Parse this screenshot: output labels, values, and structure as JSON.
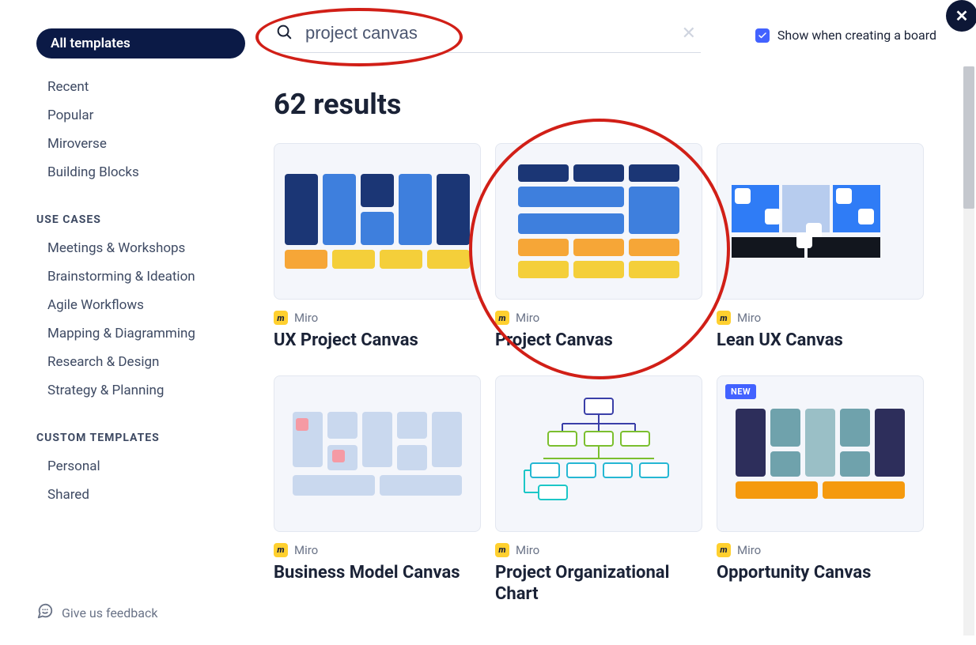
{
  "sidebar": {
    "primary_label": "All templates",
    "items": [
      "Recent",
      "Popular",
      "Miroverse",
      "Building Blocks"
    ],
    "use_cases_title": "USE CASES",
    "use_cases": [
      "Meetings & Workshops",
      "Brainstorming & Ideation",
      "Agile Workflows",
      "Mapping & Diagramming",
      "Research & Design",
      "Strategy & Planning"
    ],
    "custom_title": "CUSTOM TEMPLATES",
    "custom": [
      "Personal",
      "Shared"
    ],
    "feedback_label": "Give us feedback"
  },
  "search": {
    "value": "project canvas",
    "show_when_label": "Show when creating a board"
  },
  "results": {
    "heading": "62 results"
  },
  "cards": [
    {
      "author": "Miro",
      "title": "UX Project Canvas"
    },
    {
      "author": "Miro",
      "title": "Project Canvas"
    },
    {
      "author": "Miro",
      "title": "Lean UX Canvas"
    },
    {
      "author": "Miro",
      "title": "Business Model Canvas"
    },
    {
      "author": "Miro",
      "title": "Project Organizational Chart"
    },
    {
      "author": "Miro",
      "title": "Opportunity Canvas",
      "badge": "NEW"
    }
  ],
  "badge_text": "NEW"
}
